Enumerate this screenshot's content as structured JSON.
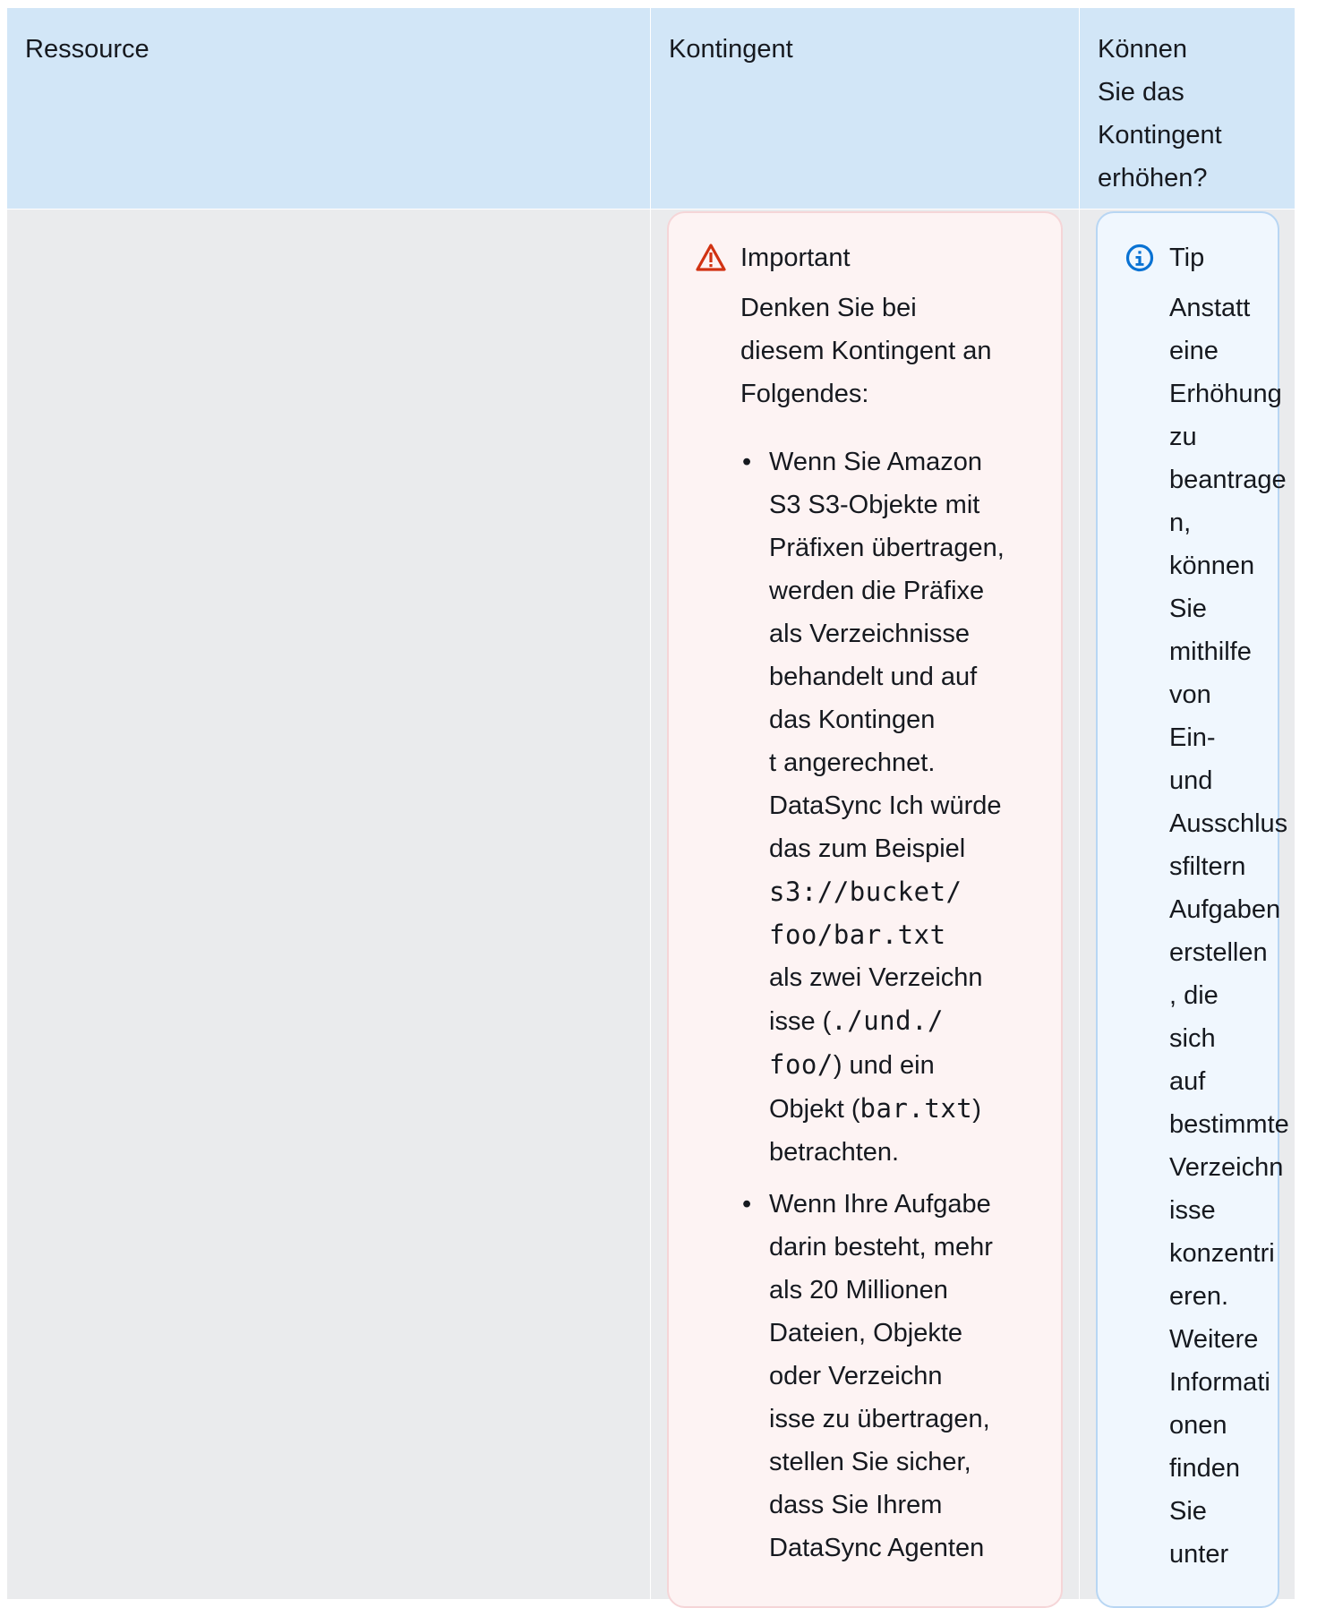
{
  "table": {
    "headers": {
      "resource": "Ressource",
      "quota": "Kontingent",
      "increase": [
        "Können",
        "Sie das",
        "Kontingent",
        "erhöhen?"
      ]
    }
  },
  "important": {
    "icon": "warning-triangle-icon",
    "title": "Important",
    "intro": [
      "Denken Sie bei",
      "diesem Kontingent an",
      "Folgendes:"
    ],
    "bullet1": {
      "lines_before": [
        "Wenn Sie Amazon",
        "S3 S3-Objekte mit",
        "Präfixen übertragen,",
        "werden die Präfixe",
        "als Verzeichnisse",
        "behandelt und auf",
        "das Kontingen",
        "t angerechnet.",
        "DataSync Ich würde",
        "das zum Beispiel"
      ],
      "code1": "s3://bucket/",
      "code2": "foo/bar.txt",
      "line_a": "als zwei Verzeichn",
      "line_b_pre": "isse (",
      "line_b_code": "./und./",
      "line_c_code": "foo/",
      "line_c_post": ") und ein",
      "line_d_pre": "Objekt (",
      "line_d_code": "bar.txt",
      "line_d_post": ")",
      "line_e": "betrachten."
    },
    "bullet2": [
      "Wenn Ihre Aufgabe",
      "darin besteht, mehr",
      "als 20 Millionen",
      "Dateien, Objekte",
      "oder Verzeichn",
      "isse zu übertragen,",
      "stellen Sie sicher,",
      "dass Sie Ihrem",
      "DataSync Agenten"
    ]
  },
  "tip": {
    "icon": "info-icon",
    "title": "Tip",
    "words": [
      "Anstatt",
      "eine",
      "Erhöhung",
      "zu",
      "beantrage",
      "n,",
      "können",
      "Sie",
      "mithilfe",
      "von",
      "Ein-",
      "und",
      "Ausschlus",
      "sfiltern",
      "Aufgaben",
      "erstellen",
      ", die",
      "sich",
      "auf",
      "bestimmte",
      "Verzeichn",
      "isse",
      "konzentri",
      "eren.",
      "Weitere",
      "Informati",
      "onen",
      "finden",
      "Sie",
      "unter"
    ]
  },
  "colors": {
    "header_bg": "#d2e6f7",
    "body_bg": "#eaebed",
    "warning_bg": "#fdf3f3",
    "warning_icon": "#d13212",
    "tip_bg": "#f0f7fe",
    "tip_icon": "#0972d3"
  }
}
